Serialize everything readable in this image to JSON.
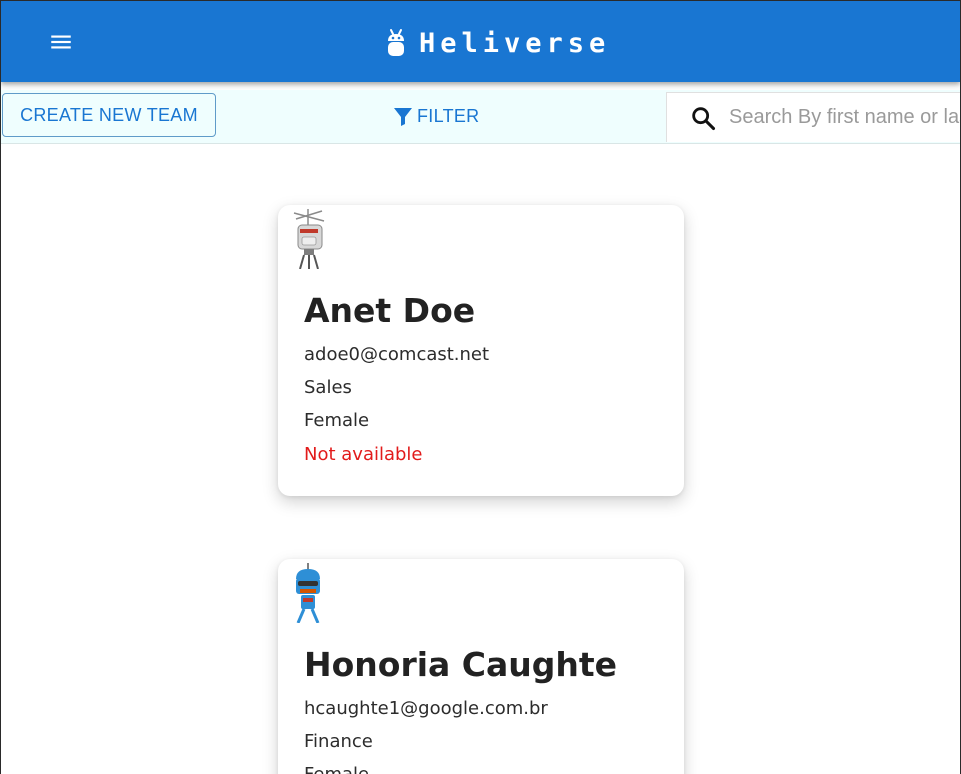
{
  "app": {
    "title": "Heliverse",
    "menu_icon": "menu-icon",
    "logo_icon": "android-robot-icon",
    "header_color": "#1976d2"
  },
  "toolbar": {
    "create_label": "CREATE NEW TEAM",
    "filter_label": "FILTER",
    "filter_icon": "filter-icon",
    "search_icon": "search-icon",
    "search_placeholder": "Search By first name or last name",
    "search_value": ""
  },
  "users": [
    {
      "name": "Anet Doe",
      "email": "adoe0@comcast.net",
      "domain": "Sales",
      "gender": "Female",
      "availability": "Not available",
      "avatar_icon": "robot-avatar-gray-icon"
    },
    {
      "name": "Honoria Caughte",
      "email": "hcaughte1@google.com.br",
      "domain": "Finance",
      "gender": "Female",
      "availability": "",
      "avatar_icon": "robot-avatar-blue-icon"
    }
  ],
  "colors": {
    "accent": "#1976d2",
    "toolbar_bg": "#effefe",
    "unavailable": "#e21b1b"
  }
}
